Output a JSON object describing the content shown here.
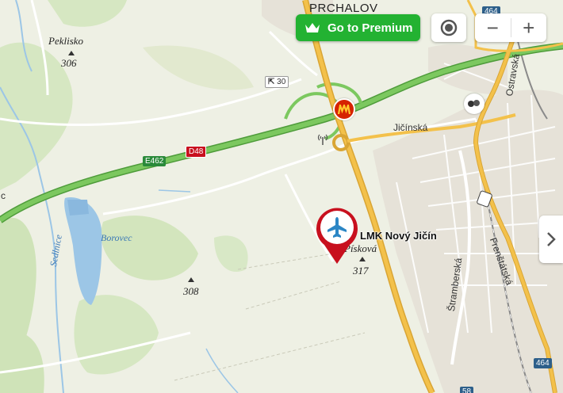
{
  "top_controls": {
    "premium_label": "Go to Premium",
    "zoom_out": "−",
    "zoom_in": "+"
  },
  "labels": {
    "town_prchalov": "PRCHALOV",
    "hill_peklisko": "Peklisko",
    "hill_peklisko_elev": "306",
    "place_borovec": "Borovec",
    "river_sedlnice": "Sedlnice",
    "hill_308": "308",
    "hill_piskova": "Písková",
    "hill_317": "317",
    "street_jicinska": "Jičínská",
    "street_ostravska": "Ostravská",
    "street_frenstatska": "Frenštátská",
    "street_stramberska": "Štramberská",
    "edge_c": "c"
  },
  "shields": {
    "e462": "E462",
    "d48": "D48",
    "r30": "30",
    "r464_top": "464",
    "r464_bottom": "464",
    "r58": "58"
  },
  "poi": {
    "airport_name": "LMK Nový Jičín"
  },
  "colors": {
    "motorway": "#6dbf52",
    "primary_road": "#f3c14b",
    "premium": "#23b232",
    "pin_red": "#c8101e",
    "pin_icon": "#2b86c5",
    "water": "#9cc6e6",
    "forest": "#cfe3b8"
  }
}
